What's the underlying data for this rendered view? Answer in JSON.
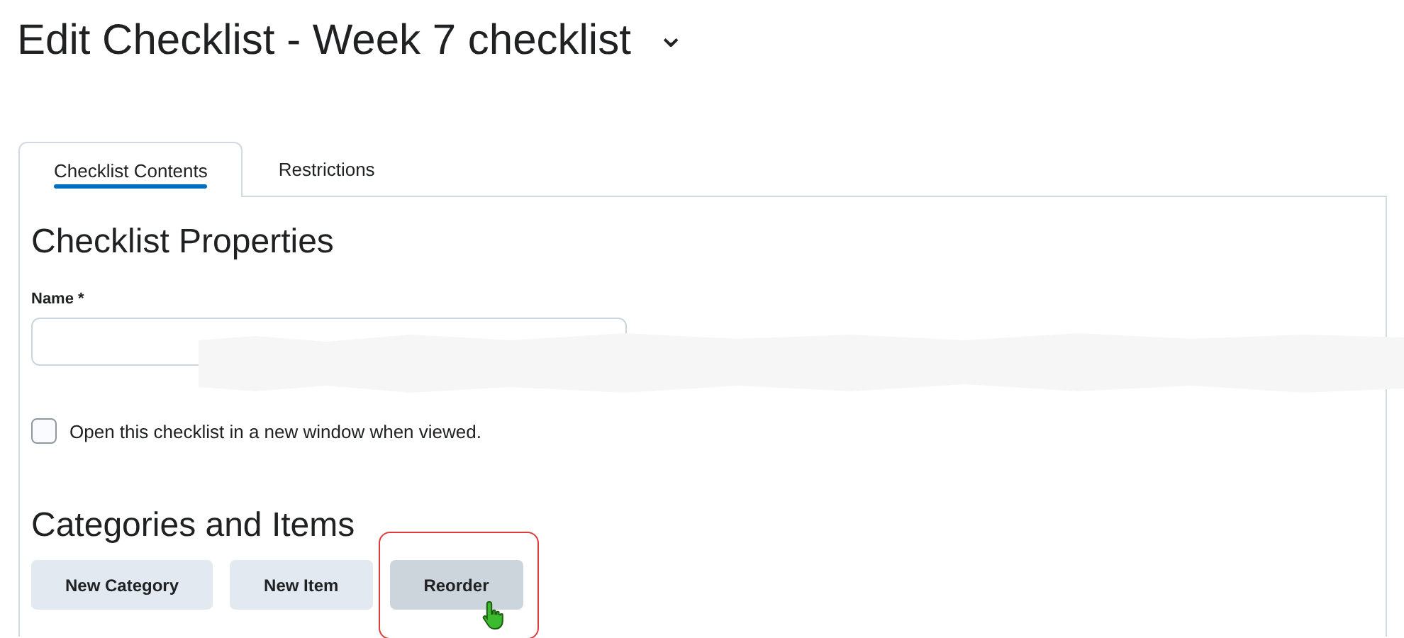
{
  "page": {
    "title": "Edit Checklist - Week 7 checklist",
    "title_menu": "⌄"
  },
  "tabs": [
    {
      "label": "Checklist Contents",
      "selected": true
    },
    {
      "label": "Restrictions",
      "selected": false
    }
  ],
  "properties": {
    "heading": "Checklist Properties",
    "name_label": "Name *",
    "new_window": {
      "label": "Open this checklist in a new window when viewed.",
      "checked": false
    }
  },
  "categories": {
    "heading": "Categories and Items",
    "buttons": [
      {
        "label": "New Category",
        "hovered": false,
        "highlighted": false
      },
      {
        "label": "New Item",
        "hovered": false,
        "highlighted": false
      },
      {
        "label": "Reorder",
        "hovered": true,
        "highlighted": true
      }
    ]
  }
}
